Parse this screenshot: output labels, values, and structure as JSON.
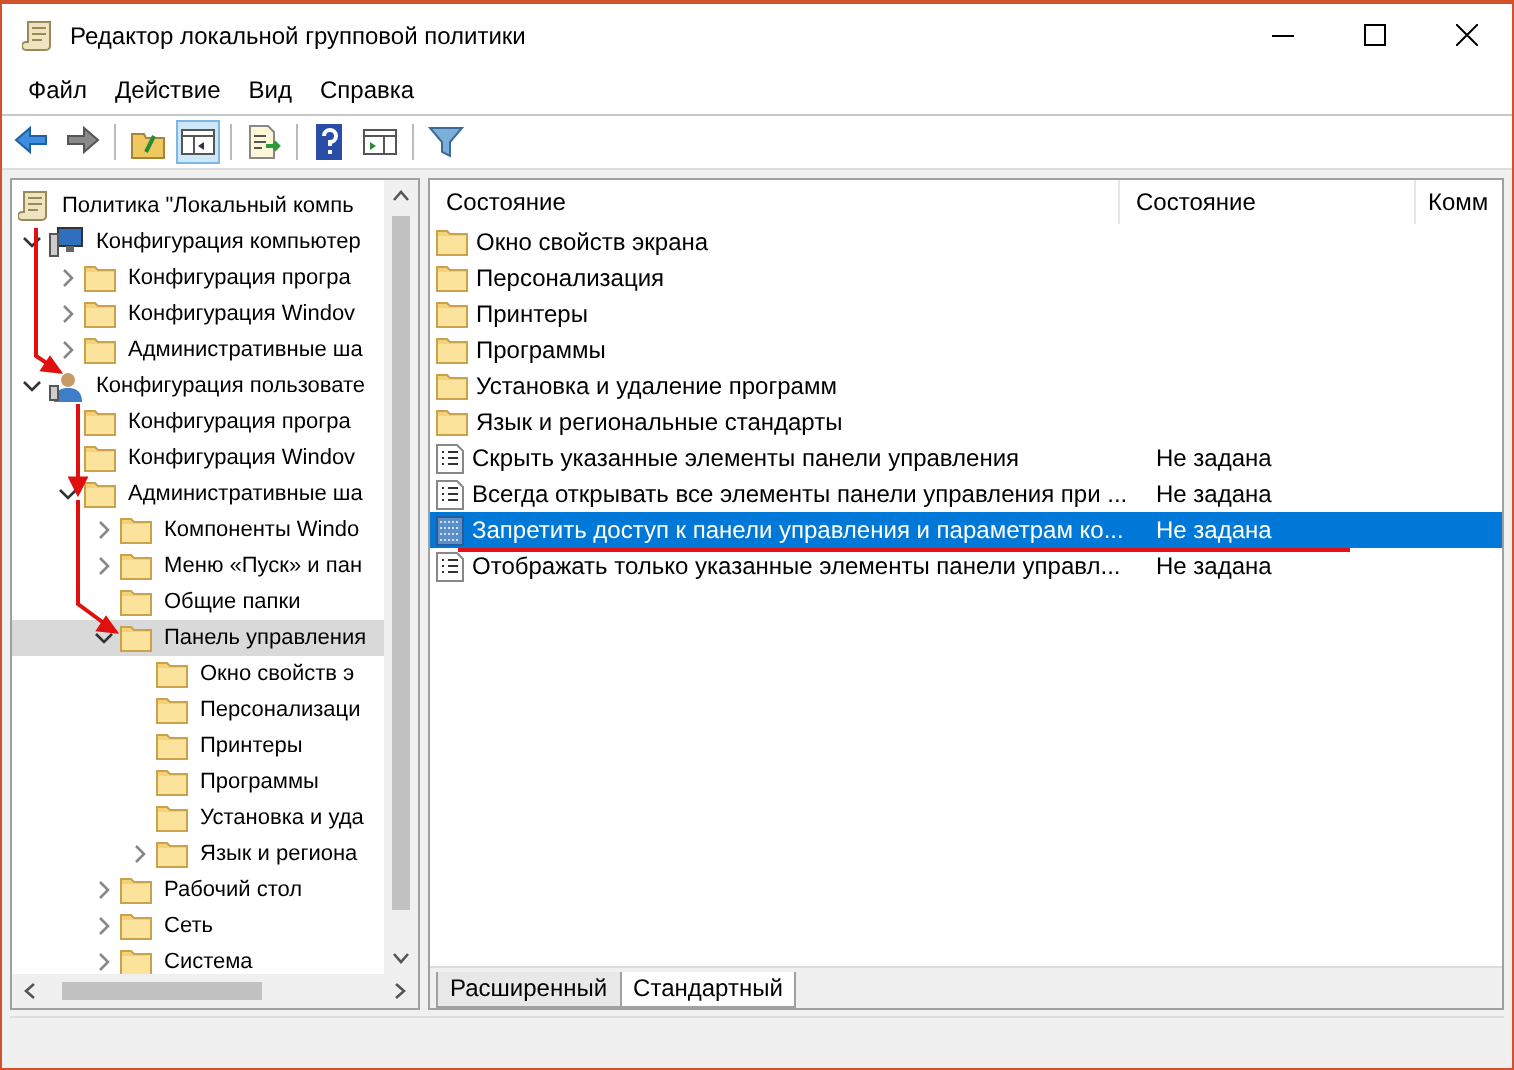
{
  "window": {
    "title": "Редактор локальной групповой политики"
  },
  "menu": [
    "Файл",
    "Действие",
    "Вид",
    "Справка"
  ],
  "toolbar": [
    {
      "kind": "back",
      "pressed": false
    },
    {
      "kind": "forward",
      "pressed": false
    },
    {
      "kind": "separator"
    },
    {
      "kind": "up",
      "pressed": false
    },
    {
      "kind": "tree",
      "pressed": true
    },
    {
      "kind": "separator"
    },
    {
      "kind": "export",
      "pressed": false
    },
    {
      "kind": "separator"
    },
    {
      "kind": "help",
      "pressed": false
    },
    {
      "kind": "pane",
      "pressed": false
    },
    {
      "kind": "separator"
    },
    {
      "kind": "filter",
      "pressed": false
    }
  ],
  "tree": [
    {
      "label": "Политика \"Локальный компь",
      "kind": "policy",
      "selected": false,
      "children": [
        {
          "label": "Конфигурация компьютер",
          "kind": "computer",
          "expanded": true,
          "selected": false,
          "children": [
            {
              "label": "Конфигурация програ",
              "kind": "folder",
              "expanded": false,
              "selected": false
            },
            {
              "label": "Конфигурация Windov",
              "kind": "folder",
              "expanded": false,
              "selected": false
            },
            {
              "label": "Административные ша",
              "kind": "folder",
              "expanded": false,
              "selected": false
            }
          ]
        },
        {
          "label": "Конфигурация пользовате",
          "kind": "user",
          "expanded": true,
          "selected": false,
          "children": [
            {
              "label": "Конфигурация програ",
              "kind": "folder",
              "selected": false
            },
            {
              "label": "Конфигурация Windov",
              "kind": "folder",
              "selected": false
            },
            {
              "label": "Административные ша",
              "kind": "folder",
              "expanded": true,
              "selected": false,
              "children": [
                {
                  "label": "Компоненты Windo",
                  "kind": "folder",
                  "expanded": false,
                  "selected": false
                },
                {
                  "label": "Меню «Пуск» и пан",
                  "kind": "folder",
                  "expanded": false,
                  "selected": false
                },
                {
                  "label": "Общие папки",
                  "kind": "folder",
                  "selected": false
                },
                {
                  "label": "Панель управления",
                  "kind": "folder",
                  "expanded": true,
                  "selected": true,
                  "children": [
                    {
                      "label": "Окно свойств э",
                      "kind": "folder",
                      "selected": false
                    },
                    {
                      "label": "Персонализаци",
                      "kind": "folder",
                      "selected": false
                    },
                    {
                      "label": "Принтеры",
                      "kind": "folder",
                      "selected": false
                    },
                    {
                      "label": "Программы",
                      "kind": "folder",
                      "selected": false
                    },
                    {
                      "label": "Установка и уда",
                      "kind": "folder",
                      "selected": false
                    },
                    {
                      "label": "Язык и региона",
                      "kind": "folder",
                      "expanded": false,
                      "selected": false
                    }
                  ]
                },
                {
                  "label": "Рабочий стол",
                  "kind": "folder",
                  "expanded": false,
                  "selected": false
                },
                {
                  "label": "Сеть",
                  "kind": "folder",
                  "expanded": false,
                  "selected": false
                },
                {
                  "label": "Система",
                  "kind": "folder",
                  "expanded": false,
                  "selected": false
                }
              ]
            }
          ]
        }
      ]
    }
  ],
  "table": {
    "columns": [
      "Состояние",
      "Состояние",
      "Комм"
    ],
    "rows": [
      {
        "kind": "folder",
        "name": "Окно свойств экрана",
        "selected": false
      },
      {
        "kind": "folder",
        "name": "Персонализация",
        "selected": false
      },
      {
        "kind": "folder",
        "name": "Принтеры",
        "selected": false
      },
      {
        "kind": "folder",
        "name": "Программы",
        "selected": false
      },
      {
        "kind": "folder",
        "name": "Установка и удаление программ",
        "selected": false
      },
      {
        "kind": "folder",
        "name": "Язык и региональные стандарты",
        "selected": false
      },
      {
        "kind": "setting",
        "name": "Скрыть указанные элементы панели управления",
        "state": "Не задана",
        "selected": false
      },
      {
        "kind": "setting",
        "name": "Всегда открывать все элементы панели управления при ...",
        "state": "Не задана",
        "selected": false
      },
      {
        "kind": "setting",
        "name": "Запретить доступ к панели управления и параметрам ко...",
        "state": "Не задана",
        "selected": true
      },
      {
        "kind": "setting",
        "name": "Отображать только указанные элементы панели управл...",
        "state": "Не задана",
        "selected": false
      }
    ]
  },
  "view_tabs": [
    {
      "label": "Расширенный",
      "selected": false
    },
    {
      "label": "Стандартный",
      "selected": true
    }
  ],
  "annotations": [
    {
      "kind": "arrow"
    },
    {
      "kind": "arrow"
    },
    {
      "kind": "arrow"
    },
    {
      "kind": "underline"
    }
  ]
}
